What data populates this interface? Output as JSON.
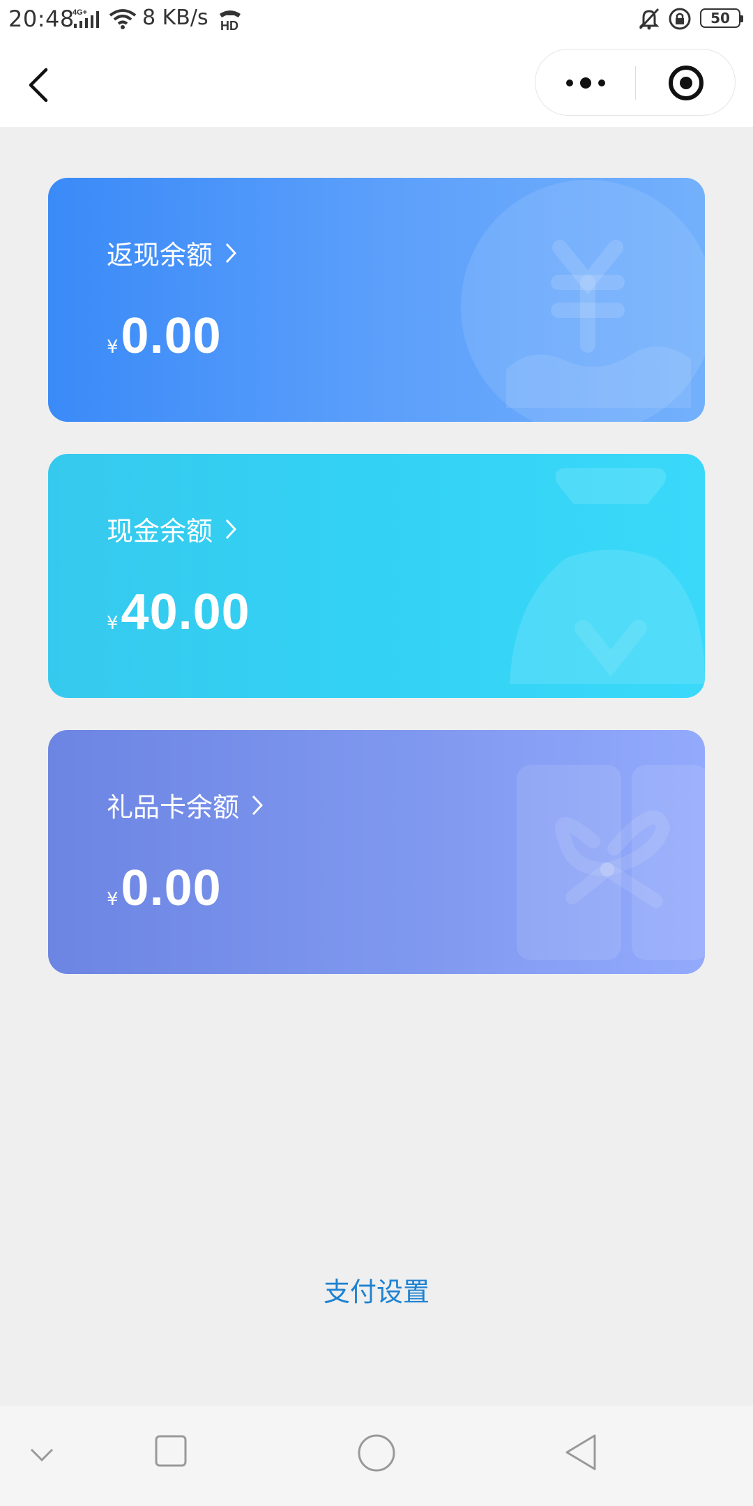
{
  "status_bar": {
    "time": "20:48",
    "network": "4G",
    "speed": "8 KB/s",
    "hd": "HD",
    "battery": "50"
  },
  "nav": {
    "back_icon": "back-chevron-icon",
    "more_icon": "more-dots-icon",
    "target_icon": "target-circle-icon"
  },
  "cards": [
    {
      "title": "返现余额",
      "currency": "¥",
      "amount": "0.00",
      "color": "#3a8af8",
      "icon": "yen-coin-icon"
    },
    {
      "title": "现金余额",
      "currency": "¥",
      "amount": "40.00",
      "color": "#36c9ee",
      "icon": "money-bag-icon"
    },
    {
      "title": "礼品卡余额",
      "currency": "¥",
      "amount": "0.00",
      "color": "#6c85e3",
      "icon": "gift-box-icon"
    }
  ],
  "payment_settings": "支付设置",
  "bottom_nav": {
    "items": [
      "collapse-chevron-icon",
      "recents-square-icon",
      "home-circle-icon",
      "back-triangle-icon"
    ]
  }
}
